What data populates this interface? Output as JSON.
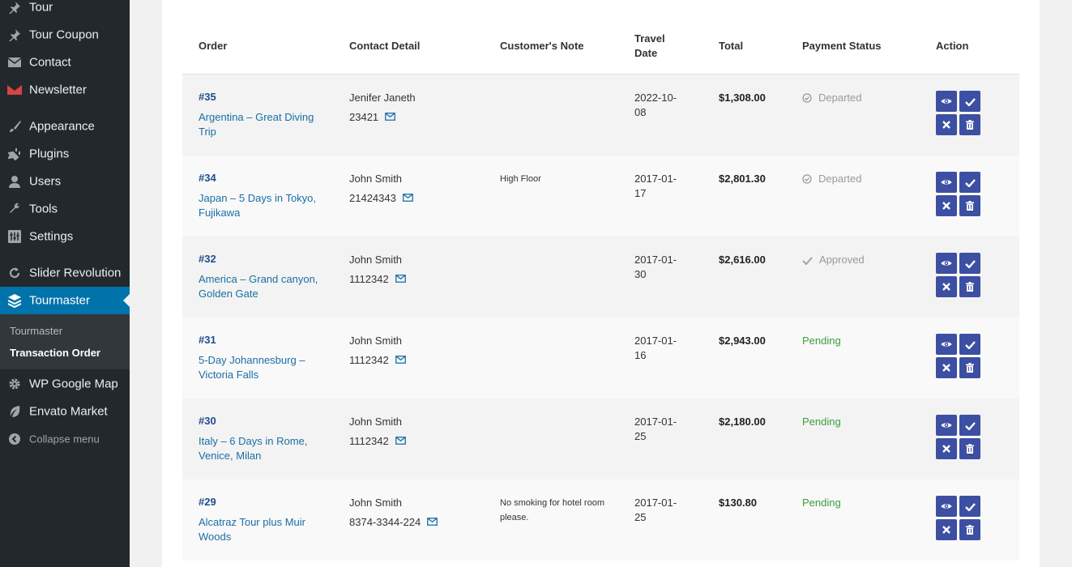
{
  "sidebar": {
    "items": [
      {
        "label": "Tour",
        "icon": "pin-icon"
      },
      {
        "label": "Tour Coupon",
        "icon": "pin-icon"
      },
      {
        "label": "Contact",
        "icon": "mail-icon"
      },
      {
        "label": "Newsletter",
        "icon": "newsletter-icon"
      },
      {
        "label": "Appearance",
        "icon": "brush-icon"
      },
      {
        "label": "Plugins",
        "icon": "plug-icon"
      },
      {
        "label": "Users",
        "icon": "user-icon"
      },
      {
        "label": "Tools",
        "icon": "wrench-icon"
      },
      {
        "label": "Settings",
        "icon": "settings-icon"
      },
      {
        "label": "Slider Revolution",
        "icon": "refresh-icon"
      },
      {
        "label": "Tourmaster",
        "icon": "layers-icon"
      },
      {
        "label": "WP Google Map",
        "icon": "gear-icon"
      },
      {
        "label": "Envato Market",
        "icon": "leaf-icon"
      },
      {
        "label": "Collapse menu",
        "icon": "collapse-icon"
      }
    ],
    "submenu": {
      "parent": "Tourmaster",
      "current": "Transaction Order"
    }
  },
  "table": {
    "headers": {
      "order": "Order",
      "contact": "Contact Detail",
      "note": "Customer's Note",
      "travel_date_1": "Travel",
      "travel_date_2": "Date",
      "total": "Total",
      "status": "Payment Status",
      "action": "Action"
    },
    "rows": [
      {
        "id": "#35",
        "title": "Argentina – Great Diving Trip",
        "name": "Jenifer Janeth",
        "phone": "23421",
        "note": "",
        "date": "2022-10-08",
        "total": "$1,308.00",
        "status": "Departed",
        "status_type": "departed"
      },
      {
        "id": "#34",
        "title": "Japan – 5 Days in Tokyo, Fujikawa",
        "name": "John Smith",
        "phone": "21424343",
        "note": "High Floor",
        "date": "2017-01-17",
        "total": "$2,801.30",
        "status": "Departed",
        "status_type": "departed"
      },
      {
        "id": "#32",
        "title": "America – Grand canyon, Golden Gate",
        "name": "John Smith",
        "phone": "1112342",
        "note": "",
        "date": "2017-01-30",
        "total": "$2,616.00",
        "status": "Approved",
        "status_type": "approved"
      },
      {
        "id": "#31",
        "title": "5-Day Johannesburg – Victoria Falls",
        "name": "John Smith",
        "phone": "1112342",
        "note": "",
        "date": "2017-01-16",
        "total": "$2,943.00",
        "status": "Pending",
        "status_type": "pending"
      },
      {
        "id": "#30",
        "title": "Italy – 6 Days in Rome, Venice, Milan",
        "name": "John Smith",
        "phone": "1112342",
        "note": "",
        "date": "2017-01-25",
        "total": "$2,180.00",
        "status": "Pending",
        "status_type": "pending"
      },
      {
        "id": "#29",
        "title": "Alcatraz Tour plus Muir Woods",
        "name": "John Smith",
        "phone": "8374-3344-224",
        "note": "No smoking for hotel room please.",
        "date": "2017-01-25",
        "total": "$130.80",
        "status": "Pending",
        "status_type": "pending"
      }
    ]
  },
  "colors": {
    "sidebar_bg": "#23282d",
    "active_menu": "#0073aa",
    "button_bg": "#3d4fa2",
    "link": "#1a6ea5",
    "pending": "#3a9e3a"
  }
}
